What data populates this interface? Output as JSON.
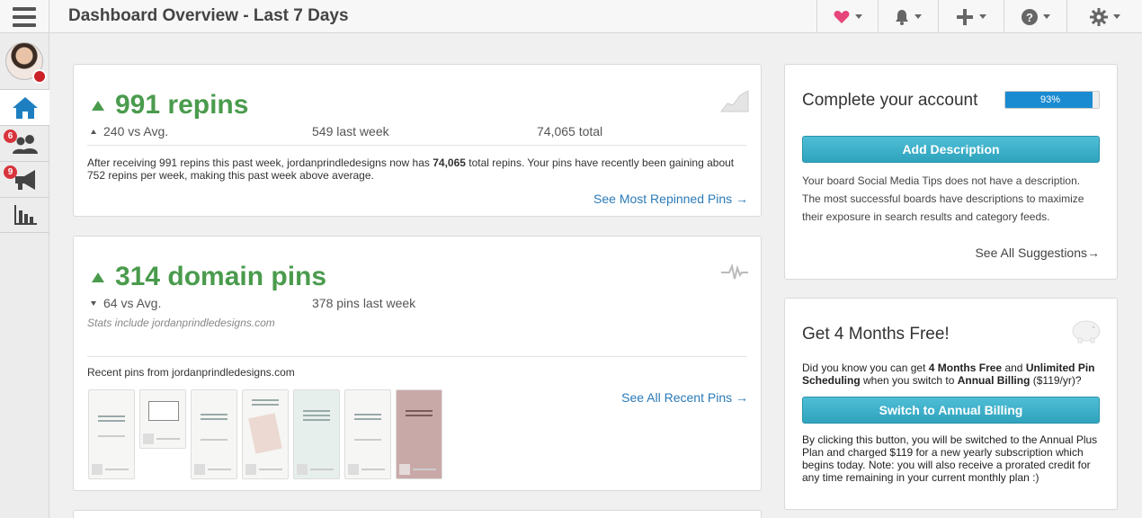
{
  "header": {
    "title": "Dashboard Overview - Last 7 Days",
    "icons": [
      "heart-icon",
      "bell-icon",
      "plus-icon",
      "help-icon",
      "gear-icon"
    ],
    "accent": "#e6457a"
  },
  "sidebar": {
    "items": [
      {
        "name": "home",
        "badge": ""
      },
      {
        "name": "followers",
        "badge": "6"
      },
      {
        "name": "promote",
        "badge": "9"
      },
      {
        "name": "analytics",
        "badge": ""
      }
    ]
  },
  "repins": {
    "headline": "991 repins",
    "vs_avg": "240 vs Avg.",
    "last_week": "549 last week",
    "total": "74,065 total",
    "desc_part1": "After receiving 991 repins this past week, jordanprindledesigns now has ",
    "desc_bold": "74,065",
    "desc_part2": " total repins. Your pins have recently been gaining about 752 repins per week, making this past week above average.",
    "link": "See Most Repinned Pins →"
  },
  "domain": {
    "headline": "314 domain pins",
    "vs_avg": "64 vs Avg.",
    "last_week": "378 pins last week",
    "note": "Stats include jordanprindledesigns.com",
    "recent_label": "Recent pins from jordanprindledesigns.com",
    "link": "See All Recent Pins →",
    "pins": [
      {
        "title": "Find Right You're Dataplexer Your Brand"
      },
      {
        "title": "BLOG"
      },
      {
        "title": "How I'm Preparing My Business for the New Year"
      },
      {
        "title": "Printable Week of My Client Onboarding Process"
      },
      {
        "title": "How to Add Related Posts to Your Blog with Squarespace Summary Blocks"
      },
      {
        "title": "How I'm Preparing My Business for the New Year"
      },
      {
        "title": "How to Set Up Blog Archives in Squarespace"
      }
    ]
  },
  "account": {
    "title": "Complete your account",
    "progress_label": "93%",
    "progress": 0.93,
    "button": "Add Description",
    "text": "Your board Social Media Tips does not have a description. The most successful boards have descriptions to maximize their exposure in search results and category feeds.",
    "link": "See All Suggestions→"
  },
  "promo": {
    "title": "Get 4 Months Free!",
    "t1": "Did you know you can get ",
    "b1": "4 Months Free",
    "t2": " and ",
    "b2": "Unlimited Pin Scheduling",
    "t3": " when you switch to ",
    "b3": "Annual Billing",
    "t4": " ($119/yr)?",
    "button": "Switch to Annual Billing",
    "fine_print": "By clicking this button, you will be switched to the Annual Plus Plan and charged $119 for a new yearly subscription which begins today. Note: you will also receive a prorated credit for any time remaining in your current monthly plan :)"
  }
}
